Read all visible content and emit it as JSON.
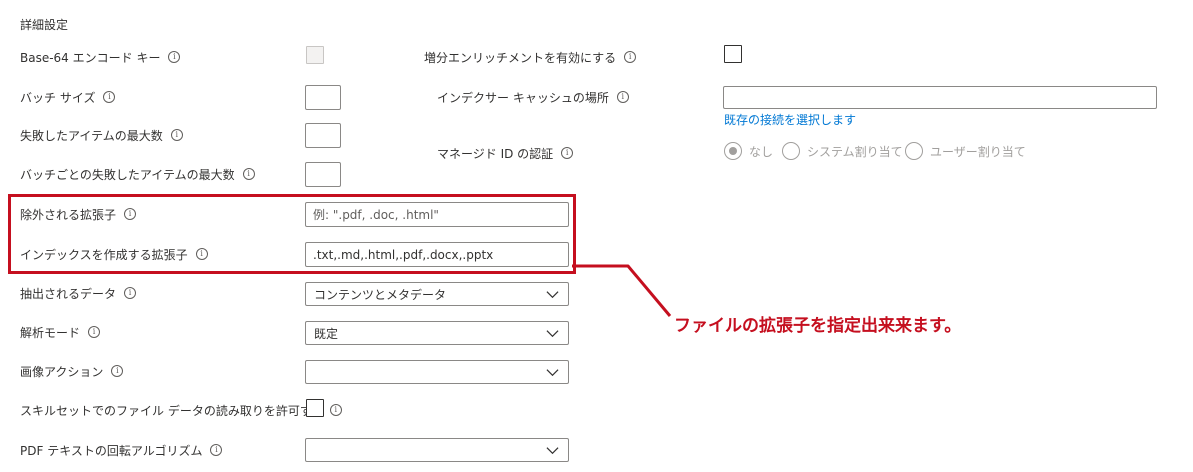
{
  "section_title": "詳細設定",
  "left_fields": {
    "base64": {
      "label": "Base-64 エンコード キー"
    },
    "batch_size": {
      "label": "バッチ サイズ"
    },
    "max_failed": {
      "label": "失敗したアイテムの最大数"
    },
    "max_failed_per_batch": {
      "label": "バッチごとの失敗したアイテムの最大数"
    },
    "excluded_ext": {
      "label": "除外される拡張子",
      "placeholder": "例: \".pdf, .doc, .html\""
    },
    "indexed_ext": {
      "label": "インデックスを作成する拡張子",
      "value": ".txt,.md,.html,.pdf,.docx,.pptx"
    },
    "extracted_data": {
      "label": "抽出されるデータ",
      "value": "コンテンツとメタデータ"
    },
    "parsing_mode": {
      "label": "解析モード",
      "value": "既定"
    },
    "image_action": {
      "label": "画像アクション",
      "value": ""
    },
    "allow_skillset": {
      "label": "スキルセットでのファイル データの読み取りを許可する"
    },
    "pdf_rotation": {
      "label": "PDF テキストの回転アルゴリズム",
      "value": ""
    }
  },
  "right_fields": {
    "incremental": {
      "label": "増分エンリッチメントを有効にする"
    },
    "cache_location": {
      "label": "インデクサー キャッシュの場所",
      "value": "",
      "link": "既存の接続を選択します"
    },
    "managed_id": {
      "label": "マネージド ID の認証",
      "options": [
        "なし",
        "システム割り当て",
        "ユーザー割り当て"
      ],
      "selected": "なし"
    }
  },
  "info_glyph": "i",
  "annotation": "ファイルの拡張子を指定出来来ます。",
  "colors": {
    "highlight": "#c50f1f",
    "link": "#0078d4"
  },
  "icons": {
    "info": "info-icon",
    "dropdown": "chevron-down-icon"
  }
}
